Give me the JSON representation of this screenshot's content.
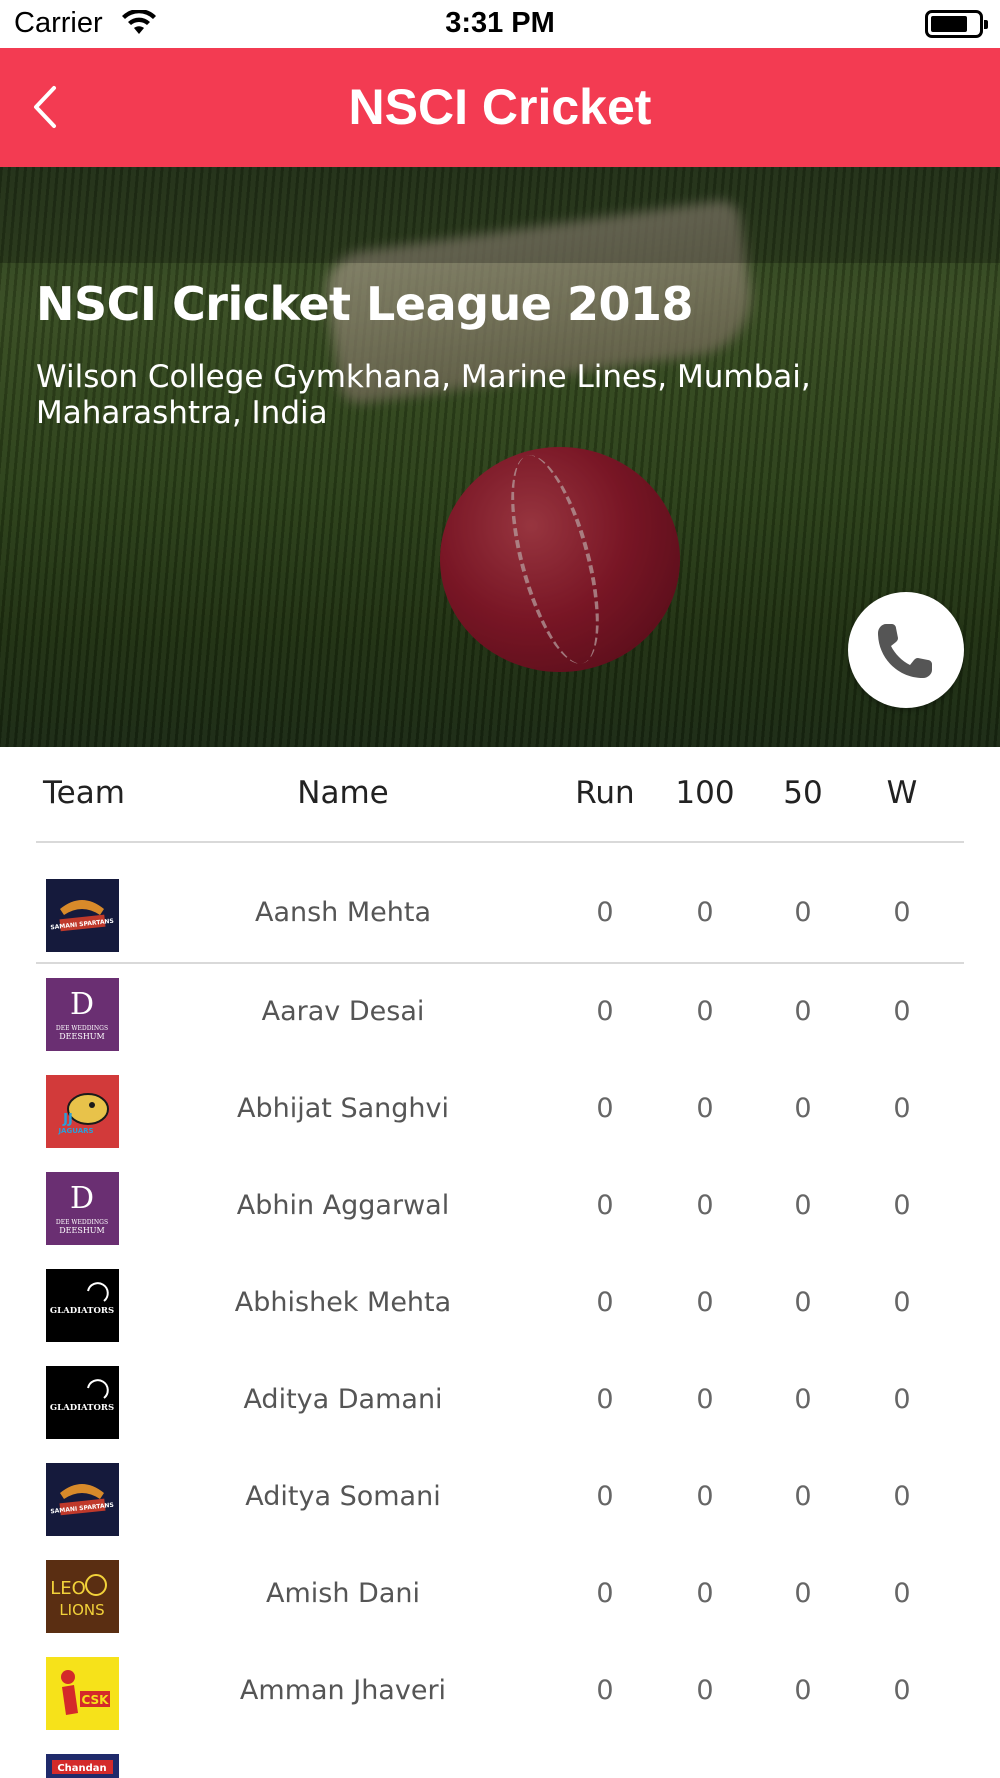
{
  "status_bar": {
    "carrier": "Carrier",
    "time": "3:31 PM",
    "wifi_icon": "wifi-icon",
    "battery_icon": "battery-icon"
  },
  "nav": {
    "title": "NSCI Cricket",
    "back_icon": "chevron-left-icon",
    "background_color": "#f33b52"
  },
  "event": {
    "title": "NSCI Cricket League 2018",
    "location": "Wilson College Gymkhana, Marine Lines, Mumbai, Maharashtra, India",
    "call_icon": "phone-icon"
  },
  "table": {
    "headers": {
      "team": "Team",
      "name": "Name",
      "run": "Run",
      "hundreds": "100",
      "fifties": "50",
      "wickets": "W"
    },
    "rows": [
      {
        "team_logo": "samani-spartans-logo",
        "name": "Aansh Mehta",
        "run": "0",
        "hundreds": "0",
        "fifties": "0",
        "wickets": "0"
      },
      {
        "team_logo": "dee-weddings-deeshum-logo",
        "name": "Aarav Desai",
        "run": "0",
        "hundreds": "0",
        "fifties": "0",
        "wickets": "0"
      },
      {
        "team_logo": "jj-jaguars-logo",
        "name": "Abhijat Sanghvi",
        "run": "0",
        "hundreds": "0",
        "fifties": "0",
        "wickets": "0"
      },
      {
        "team_logo": "dee-weddings-deeshum-logo",
        "name": "Abhin Aggarwal",
        "run": "0",
        "hundreds": "0",
        "fifties": "0",
        "wickets": "0"
      },
      {
        "team_logo": "gladiators-logo",
        "name": "Abhishek Mehta",
        "run": "0",
        "hundreds": "0",
        "fifties": "0",
        "wickets": "0"
      },
      {
        "team_logo": "gladiators-logo",
        "name": "Aditya Damani",
        "run": "0",
        "hundreds": "0",
        "fifties": "0",
        "wickets": "0"
      },
      {
        "team_logo": "samani-spartans-logo",
        "name": "Aditya Somani",
        "run": "0",
        "hundreds": "0",
        "fifties": "0",
        "wickets": "0"
      },
      {
        "team_logo": "leo-lions-logo",
        "name": "Amish Dani",
        "run": "0",
        "hundreds": "0",
        "fifties": "0",
        "wickets": "0"
      },
      {
        "team_logo": "csk-hot-shots-logo",
        "name": "Amman Jhaveri",
        "run": "0",
        "hundreds": "0",
        "fifties": "0",
        "wickets": "0"
      },
      {
        "team_logo": "chandan-logo",
        "name": "",
        "run": "",
        "hundreds": "",
        "fifties": "",
        "wickets": ""
      }
    ]
  },
  "logo_text": {
    "samani": "SAMANI SPARTANS",
    "deeshum_top": "DEE WEDDINGS",
    "deeshum_bottom": "DEESHUM",
    "jaguars": "JAGUARS",
    "gladiators": "GLADIATORS",
    "leo_top": "LEO",
    "leo_bottom": "LIONS",
    "csk": "CSK",
    "chandan": "Chandan"
  }
}
